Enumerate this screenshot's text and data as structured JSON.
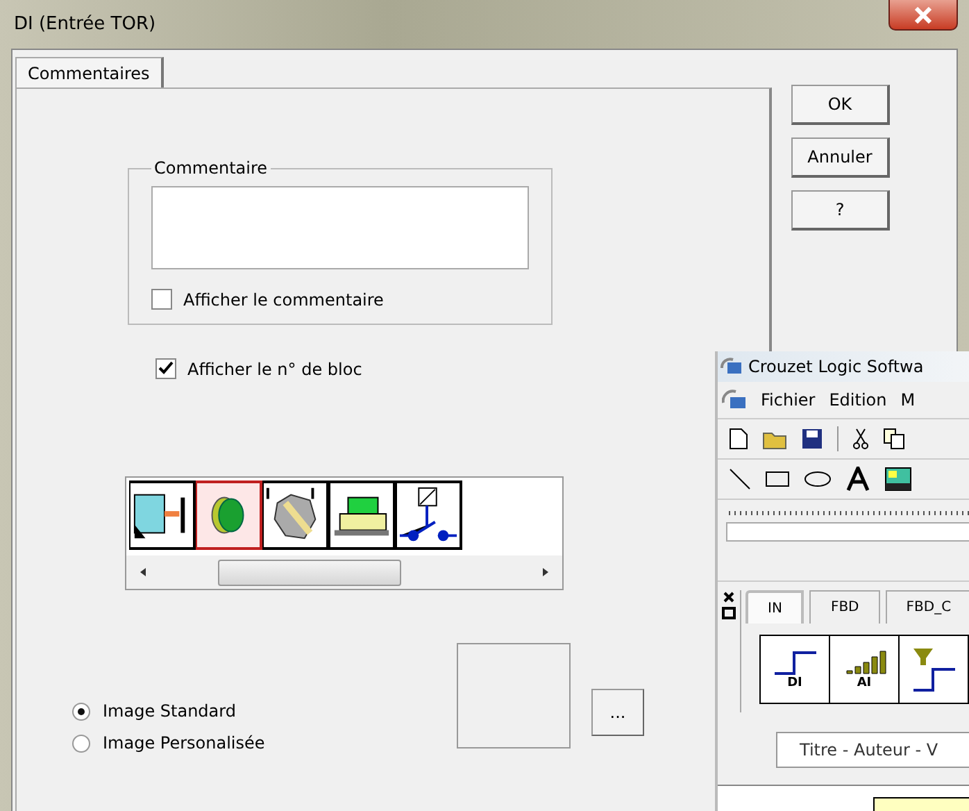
{
  "window": {
    "title": "DI (Entrée TOR)"
  },
  "tabs": [
    {
      "label": "Commentaires",
      "selected": true
    }
  ],
  "comment_group": {
    "title": "Commentaire",
    "show_comment": {
      "label": "Afficher le commentaire",
      "checked": false
    }
  },
  "show_block_number": {
    "label": "Afficher le n° de bloc",
    "checked": true
  },
  "images": [
    {
      "kind": "sensor",
      "selected": false
    },
    {
      "kind": "pushbutton",
      "selected": true
    },
    {
      "kind": "selector",
      "selected": false
    },
    {
      "kind": "key",
      "selected": false
    },
    {
      "kind": "contact",
      "selected": false
    }
  ],
  "image_options": [
    {
      "label": "Image Standard",
      "selected": true
    },
    {
      "label": "Image Personalisée",
      "selected": false
    }
  ],
  "browse_button": "...",
  "buttons": [
    "OK",
    "Annuler",
    "?"
  ],
  "background_window": {
    "title": "Crouzet Logic Softwa",
    "menu": [
      "Fichier",
      "Edition",
      "M"
    ],
    "palette_tabs": [
      {
        "label": "IN",
        "selected": true
      },
      {
        "label": "FBD",
        "selected": false
      },
      {
        "label": "FBD_C",
        "selected": false
      }
    ],
    "palette_items": [
      {
        "kind": "di",
        "label": "DI"
      },
      {
        "kind": "ai",
        "label": "AI"
      },
      {
        "kind": "filter"
      }
    ],
    "title_field": "Titre - Auteur - V"
  }
}
